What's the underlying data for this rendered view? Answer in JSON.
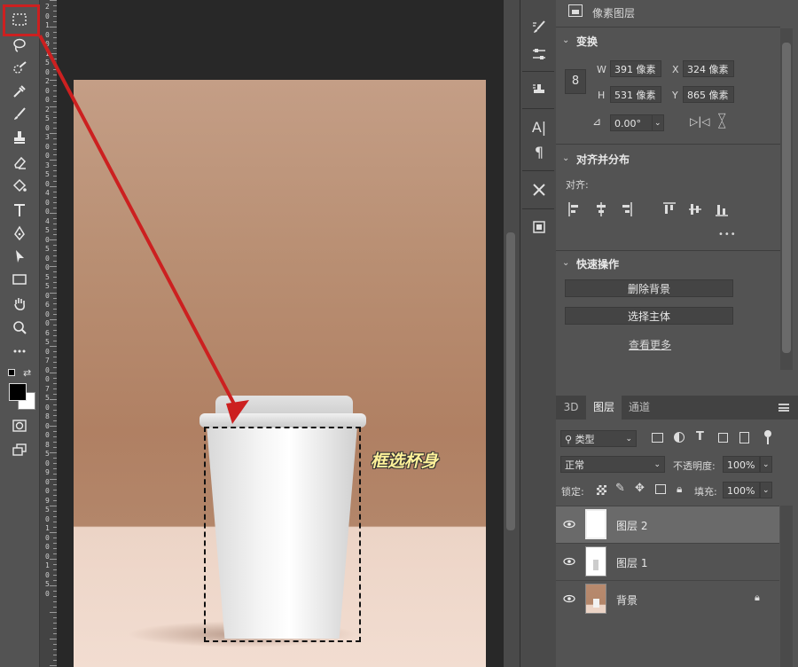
{
  "properties_panel": {
    "layer_type": "像素图层",
    "transform": {
      "title": "变换",
      "w_label": "W",
      "w_value": "391 像素",
      "x_label": "X",
      "x_value": "324 像素",
      "h_label": "H",
      "h_value": "531 像素",
      "y_label": "Y",
      "y_value": "865 像素",
      "angle_value": "0.00°"
    },
    "align": {
      "title": "对齐并分布",
      "align_label": "对齐:",
      "more": "•••"
    },
    "quick_actions": {
      "title": "快速操作",
      "remove_bg": "删除背景",
      "select_subject": "选择主体",
      "see_more": "查看更多"
    }
  },
  "layers_panel": {
    "tabs": [
      "3D",
      "图层",
      "通道"
    ],
    "active_tab": "图层",
    "filter_kind": "类型",
    "blend_mode": "正常",
    "opacity_label": "不透明度:",
    "opacity_value": "100%",
    "lock_label": "锁定:",
    "fill_label": "填充:",
    "fill_value": "100%",
    "layers": [
      {
        "name": "图层 2",
        "selected": true
      },
      {
        "name": "图层 1",
        "selected": false
      },
      {
        "name": "背景",
        "selected": false,
        "locked": true
      }
    ]
  },
  "ruler": {
    "labels": [
      "2",
      "0",
      "1",
      "0",
      "0",
      "1",
      "5",
      "0",
      "2",
      "0",
      "0",
      "2",
      "5",
      "0",
      "3",
      "0",
      "0",
      "3",
      "5",
      "0",
      "4",
      "0",
      "0",
      "4",
      "5",
      "0",
      "5",
      "0",
      "0",
      "5",
      "5",
      "0",
      "6",
      "0",
      "0",
      "6",
      "5",
      "0",
      "7",
      "0",
      "0",
      "7",
      "5",
      "0",
      "8",
      "0",
      "0",
      "8",
      "5",
      "0",
      "9",
      "0",
      "0",
      "9",
      "5",
      "0",
      "1",
      "0",
      "0",
      "0",
      "1",
      "0",
      "5",
      "0"
    ]
  },
  "annotation": "框选杯身",
  "colors": {
    "accent_highlight": "#cc2020",
    "annotation_text": "#fff29a",
    "foreground_swatch": "#000000",
    "background_swatch": "#ffffff"
  },
  "tools": [
    "rect-marquee-icon",
    "lasso-icon",
    "quick-select-icon",
    "eyedropper-icon",
    "brush-icon",
    "clone-stamp-icon",
    "eraser-icon",
    "paint-bucket-icon",
    "type-icon",
    "pen-icon",
    "path-select-icon",
    "rectangle-icon",
    "hand-icon",
    "zoom-icon",
    "more-tools-icon"
  ]
}
